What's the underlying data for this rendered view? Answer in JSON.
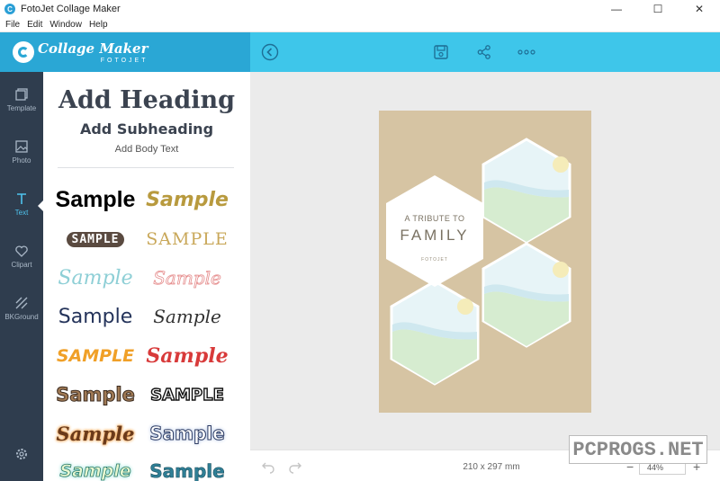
{
  "window": {
    "title": "FotoJet Collage Maker",
    "minimize": "—",
    "maximize": "☐",
    "close": "✕"
  },
  "menu": [
    "File",
    "Edit",
    "Window",
    "Help"
  ],
  "logo": {
    "main": "Collage Maker",
    "sub": "FOTOJET"
  },
  "toolbar": {
    "icons": [
      "back-circle-icon",
      "save-icon",
      "share-icon",
      "more-icon"
    ]
  },
  "rail": {
    "items": [
      {
        "label": "Template",
        "icon": "template-icon"
      },
      {
        "label": "Photo",
        "icon": "photo-icon"
      },
      {
        "label": "Text",
        "icon": "text-icon",
        "active": true
      },
      {
        "label": "Clipart",
        "icon": "heart-icon"
      },
      {
        "label": "BKGround",
        "icon": "background-icon"
      }
    ],
    "settings_icon": "gear-icon"
  },
  "text_panel": {
    "heading": "Add Heading",
    "subheading": "Add Subheading",
    "body": "Add Body Text",
    "samples": [
      {
        "text": "Sample",
        "style": "heavy-black"
      },
      {
        "text": "Sample",
        "style": "gold-italic"
      },
      {
        "text": "SAMPLE",
        "style": "pill-dark"
      },
      {
        "text": "SAMPLE",
        "style": "gold-serif"
      },
      {
        "text": "Sample",
        "style": "teal-script"
      },
      {
        "text": "Sample",
        "style": "pink-outline-script"
      },
      {
        "text": "Sample",
        "style": "navy-handwritten"
      },
      {
        "text": "Sample",
        "style": "thin-script"
      },
      {
        "text": "SAMPLE",
        "style": "orange-brush"
      },
      {
        "text": "Sample",
        "style": "red-script"
      },
      {
        "text": "Sample",
        "style": "brown-outline"
      },
      {
        "text": "SAMPLE",
        "style": "black-outline"
      },
      {
        "text": "Sample",
        "style": "brown-script-glow"
      },
      {
        "text": "Sample",
        "style": "navy-glow"
      },
      {
        "text": "Sample",
        "style": "teal-glow"
      },
      {
        "text": "Sample",
        "style": "teal-outline"
      }
    ]
  },
  "canvas": {
    "background": "#d6c4a3",
    "tribute": "A TRIBUTE TO",
    "family": "FAMILY",
    "mark": "FOTOJET"
  },
  "status": {
    "page_size": "210 x 297 mm",
    "zoom": "44%",
    "zoom_minus": "−",
    "zoom_plus": "+"
  },
  "watermark": "PCPROGS.NET",
  "colors": {
    "brand_blue": "#2aa7d5",
    "toolbar_blue": "#3ec6ea",
    "rail": "#2f3d4e",
    "active": "#4fc3ee"
  }
}
